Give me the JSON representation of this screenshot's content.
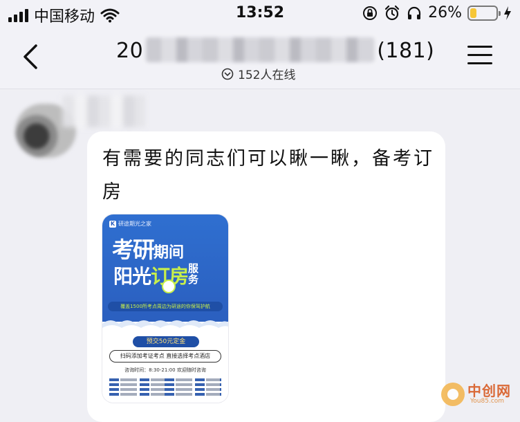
{
  "status_bar": {
    "carrier": "中国移动",
    "time": "13:52",
    "battery_percent_label": "26%",
    "battery_level": 0.26,
    "battery_color": "#f6c637",
    "icons": [
      "signal-icon",
      "wifi-icon",
      "orientation-lock-icon",
      "alarm-icon",
      "headphones-icon",
      "battery-icon",
      "charging-icon"
    ]
  },
  "header": {
    "title_prefix": "20",
    "title_suffix": "(181)",
    "online_count": "152人在线",
    "back_icon": "chevron-left-icon",
    "menu_icon": "hamburger-menu-icon"
  },
  "message": {
    "text": "有需要的同志们可以瞅一瞅，备考订房",
    "image": {
      "brand": "研途期光之家",
      "title_line1_a": "考研",
      "title_line1_b": "期间",
      "title_line2_a": "阳光",
      "title_line2_b": "订房",
      "title_line2_c": "服务",
      "band_text": "覆盖1500所考点周边为研途的你保驾护航",
      "deposit": "预交50元定金",
      "line1": "扫码添加考证考点 直接选择考点酒店",
      "line2": "咨询时间：8:30-21:00 欢迎随时咨询"
    }
  },
  "watermark": {
    "name": "中创网",
    "domain": "You85.com"
  }
}
